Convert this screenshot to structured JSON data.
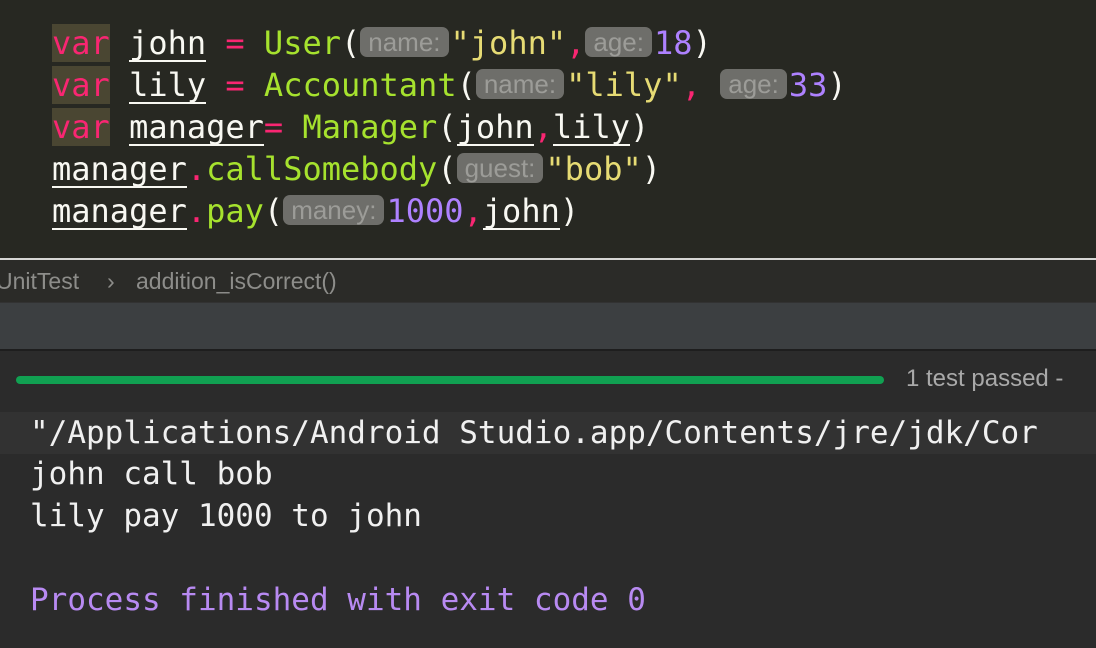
{
  "editor": {
    "lines": [
      {
        "kw": "var",
        "name": "john",
        "eq": " = ",
        "fn": "User",
        "open": "(",
        "hint1": "name:",
        "arg1": "\"john\"",
        "comma": ",",
        "hint2": "age:",
        "arg2": "18",
        "close": ")"
      },
      {
        "kw": "var",
        "name": "lily",
        "eq": " = ",
        "fn": "Accountant",
        "open": "(",
        "hint1": "name:",
        "arg1": "\"lily\"",
        "comma": ", ",
        "hint2": "age:",
        "arg2": "33",
        "close": ")"
      },
      {
        "kw": "var",
        "name": "manager",
        "eq": "= ",
        "fn": "Manager",
        "open": "(",
        "arg1": "john",
        "comma": ",",
        "arg2": "lily",
        "close": ")"
      },
      {
        "obj": "manager",
        "dot": ".",
        "fn": "callSomebody",
        "open": "(",
        "hint1": "guest:",
        "arg1": "\"bob\"",
        "close": ")"
      },
      {
        "obj": "manager",
        "dot": ".",
        "fn": "pay",
        "open": "(",
        "hint1": "maney:",
        "arg1": "1000",
        "comma": ",",
        "arg2": "john",
        "close": ")"
      }
    ]
  },
  "breadcrumb": {
    "class_name": "UnitTest",
    "separator": "›",
    "method": "addition_isCorrect()"
  },
  "test_run": {
    "progress": 1.0,
    "status": "1 test passed -"
  },
  "console": {
    "command": "\"/Applications/Android Studio.app/Contents/jre/jdk/Cor",
    "output": [
      "john call bob",
      "lily pay 1000 to john"
    ],
    "process": "Process finished with exit code 0"
  },
  "colors": {
    "keyword": "#f92672",
    "function": "#a6e22e",
    "string": "#e6db74",
    "number": "#ae81ff",
    "progress": "#11a052",
    "process": "#b88af2"
  }
}
